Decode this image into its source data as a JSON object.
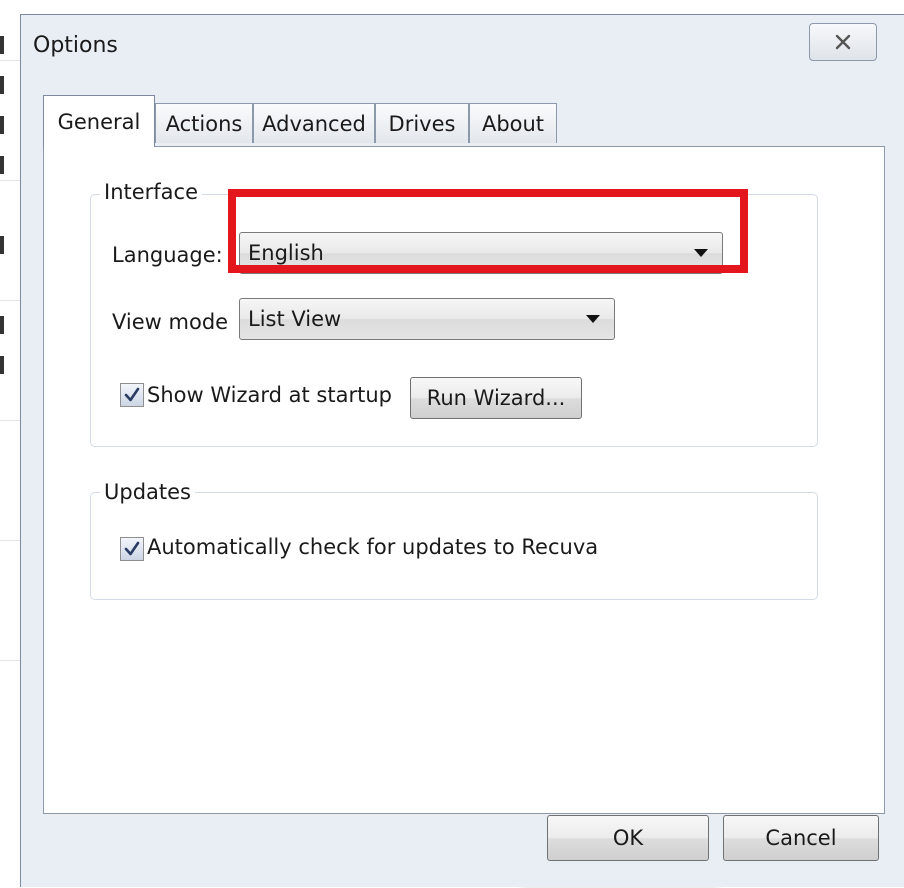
{
  "window": {
    "title": "Options",
    "close_glyph": "✕"
  },
  "tabs": [
    {
      "label": "General",
      "active": true
    },
    {
      "label": "Actions",
      "active": false
    },
    {
      "label": "Advanced",
      "active": false
    },
    {
      "label": "Drives",
      "active": false
    },
    {
      "label": "About",
      "active": false
    }
  ],
  "interface": {
    "group_title": "Interface",
    "language_label": "Language:",
    "language_value": "English",
    "view_mode_label": "View mode",
    "view_mode_value": "List View",
    "show_wizard_label": "Show Wizard at startup",
    "show_wizard_checked": true,
    "run_wizard_label": "Run Wizard..."
  },
  "updates": {
    "group_title": "Updates",
    "auto_check_label": "Automatically check for updates to Recuva",
    "auto_check_checked": true
  },
  "footer": {
    "ok_label": "OK",
    "cancel_label": "Cancel"
  },
  "annotation": {
    "highlight_color": "#e3161e"
  },
  "icons": {
    "close": "close-icon",
    "dropdown": "chevron-down-icon",
    "check": "check-icon"
  }
}
